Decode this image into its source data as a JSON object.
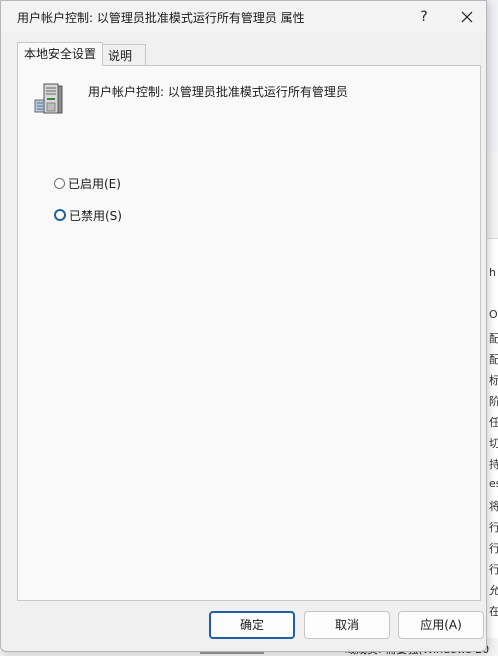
{
  "dialog": {
    "title": "用户帐户控制: 以管理员批准模式运行所有管理员 属性",
    "help_label": "?",
    "tabs": [
      {
        "label": "本地安全设置",
        "active": true
      },
      {
        "label": "说明",
        "active": false
      }
    ],
    "policy_name": "用户帐户控制: 以管理员批准模式运行所有管理员",
    "options": [
      {
        "label": "已启用(E)",
        "checked": false
      },
      {
        "label": "已禁用(S)",
        "checked": true
      }
    ],
    "buttons": {
      "ok": "确定",
      "cancel": "取消",
      "apply": "应用(A)"
    }
  },
  "background_window": {
    "column_fragments": [
      "h",
      "OL",
      "配",
      "配",
      "标",
      "阶",
      "任",
      "切",
      "持",
      "es",
      "将",
      "行",
      "行",
      "行",
      "允",
      "在"
    ],
    "bottom_text": "域成员: 需要强(Windows 20"
  },
  "colors": {
    "accent": "#1f5fa5",
    "dialog_bg": "#f0f0f0",
    "panel_bg": "#f9f9f9"
  },
  "icons": {
    "policy": "server-policy-icon",
    "close": "close-icon"
  }
}
